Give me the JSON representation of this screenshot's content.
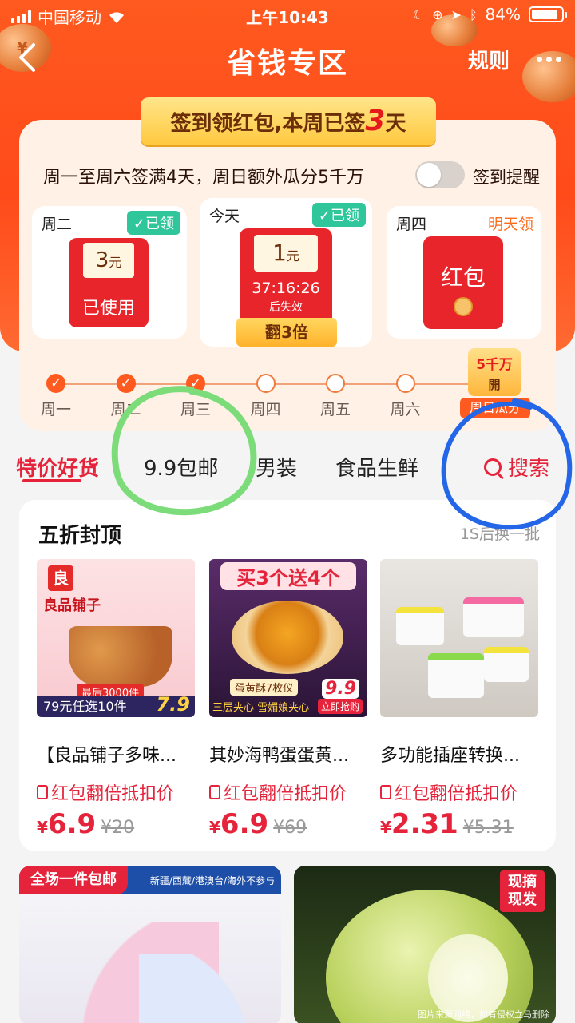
{
  "status_bar": {
    "carrier": "中国移动",
    "time": "上午10:43",
    "battery": "84%"
  },
  "nav": {
    "title": "省钱专区",
    "rules": "规则"
  },
  "signin": {
    "banner_prefix": "签到领红包,本周已签",
    "banner_days": "3",
    "banner_suffix": "天",
    "rule_text": "周一至周六签满4天，周日额外瓜分5千万",
    "reminder_label": "签到提醒",
    "cards": [
      {
        "day": "周二",
        "status": "✓已领",
        "amount": "3",
        "unit": "元",
        "state": "已使用"
      },
      {
        "day": "今天",
        "status": "✓已领",
        "amount": "1",
        "unit": "元",
        "countdown": "37:16:26",
        "countdown_suffix": "后失效",
        "action": "翻3倍"
      },
      {
        "day": "周四",
        "status": "明天领",
        "label": "红包"
      }
    ],
    "progress": [
      "周一",
      "周二",
      "周三",
      "周四",
      "周五",
      "周六"
    ],
    "checked_days": 3,
    "bonus_top": "5千万",
    "bonus_mid": "開",
    "bonus_label": "周日瓜分"
  },
  "tabs": {
    "items": [
      "特价好货",
      "9.9包邮",
      "男装",
      "食品生鲜"
    ],
    "search": "搜索"
  },
  "section": {
    "title": "五折封顶",
    "refresh": "1S后换一批",
    "products": [
      {
        "name": "【良品铺子多味...",
        "promo": "红包翻倍抵扣价",
        "price": "6.9",
        "original": "¥20",
        "img_brand": "良品铺子",
        "img_badge": "最后3000件",
        "img_offer": "79元任选10件",
        "img_price": "7.9"
      },
      {
        "name": "其妙海鸭蛋蛋黄...",
        "promo": "红包翻倍抵扣价",
        "price": "6.9",
        "original": "¥69",
        "img_headline": "买3个送4个",
        "img_sub": "蛋黄酥7枚仪",
        "img_slogan": "三层夹心 雪媚娘夹心",
        "img_price": "9.9",
        "img_buy": "立即抢购"
      },
      {
        "name": "多功能插座转换...",
        "promo": "红包翻倍抵扣价",
        "price": "2.31",
        "original": "¥5.31"
      }
    ],
    "currency": "¥"
  },
  "banners": {
    "left_tag": "全场一件包邮",
    "left_note": "新疆/西藏/港澳台/海外不参与",
    "right_tag": "现摘现发",
    "watermark": "图片来源网络，如有侵权立马删除"
  },
  "colors": {
    "brand": "#ff5a1f",
    "accent": "#e5243b",
    "gold": "#ffc93e",
    "green_ok": "#2fc69b"
  }
}
